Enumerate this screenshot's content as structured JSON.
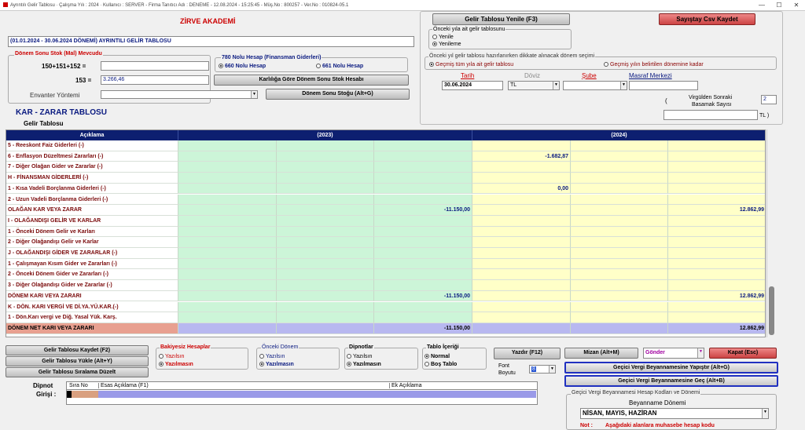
{
  "titlebar": {
    "text": "Ayrıntılı Gelir Tablosu  ·  Çalışma Yılı : 2024  ·  Kullanıcı : SERVER - Firma Tanıtıcı Adı : DENEME - 12.08.2024 - 15:25:45 - Müş.No : 800257 - Ver.No : 010824-05.1",
    "min": "—",
    "max": "☐",
    "close": "✕"
  },
  "company": "ZİRVE AKADEMİ",
  "report_title": "(01.01.2024  -  30.06.2024 DÖNEMİ) AYRINTILI GELİR TABLOSU",
  "stock": {
    "group": "Dönem Sonu Stok (Mal) Mevcudu",
    "label1": "150+151+152 =",
    "label2": "153 =",
    "value2": "3.266,46",
    "envanter_label": "Envanter Yöntemi"
  },
  "hesap780": {
    "title": "780 Nolu Hesap (Finansman Giderleri)",
    "opt1": "660 Nolu Hesap",
    "opt2": "661 Nolu Hesap"
  },
  "btn_karlilik": "Karlılığa Göre Dönem Sonu Stok Hesabı",
  "btn_donem_sonu": "Dönem Sonu Stoğu (Alt+G)",
  "kar_zarar": "KAR - ZARAR TABLOSU",
  "gelir_tablosu": "Gelir Tablosu",
  "btn_yenile": "Gelir Tablosu Yenile (F3)",
  "btn_sayistay": "Sayıştay Csv Kaydet",
  "onceki": {
    "title": "Önceki yıla ait gelir tablosunu",
    "opt1": "Yenile",
    "opt2": "Yenileme"
  },
  "secim": {
    "title": "Önceki yıl gelir tablosu hazırlanırken dikkate alınacak dönem seçimi",
    "opt1": "Geçmiş tüm yıla ait gelir tablosu",
    "opt2": "Geçmiş yılın belirtilen dönemine kadar"
  },
  "filters": {
    "tarih_label": "Tarih",
    "tarih": "30.06.2024",
    "doviz_label": "Döviz",
    "doviz": "TL",
    "sube_label": "Şube",
    "masraf_label": "Masraf Merkezi"
  },
  "basamak": {
    "label1": "Virgülden Sonraki",
    "label2": "Basamak Sayısı",
    "value": "2",
    "paren_open": "(",
    "paren_close": "TL )"
  },
  "grid": {
    "headers": [
      "Açıklama",
      "(2023)",
      "(2024)"
    ],
    "rows": [
      {
        "label": "5 - Reeskont Faiz Giderleri (-)",
        "a": "",
        "b": "",
        "c": "",
        "d": ""
      },
      {
        "label": "6 - Enflasyon Düzeltmesi Zararları (-)",
        "a": "",
        "b": "",
        "c": "-1.682,87",
        "d": ""
      },
      {
        "label": "7 - Diğer Olağan Gider ve Zararlar (-)",
        "a": "",
        "b": "",
        "c": "",
        "d": ""
      },
      {
        "label": "H - FİNANSMAN GİDERLERİ (-)",
        "a": "",
        "b": "",
        "c": "",
        "d": ""
      },
      {
        "label": "1 - Kısa Vadeli Borçlanma Giderleri (-)",
        "a": "",
        "b": "",
        "c": "0,00",
        "d": ""
      },
      {
        "label": "2 - Uzun Vadeli Borçlanma Giderleri (-)",
        "a": "",
        "b": "",
        "c": "",
        "d": ""
      },
      {
        "label": "OLAĞAN KAR VEYA ZARAR",
        "a": "",
        "b": "-11.150,00",
        "c": "",
        "d": "12.862,99"
      },
      {
        "label": "I - OLAĞANDIŞI GELİR VE KARLAR",
        "a": "",
        "b": "",
        "c": "",
        "d": ""
      },
      {
        "label": "1 - Önceki Dönem Gelir ve Karları",
        "a": "",
        "b": "",
        "c": "",
        "d": ""
      },
      {
        "label": "2 - Diğer Olağandışı Gelir ve Karlar",
        "a": "",
        "b": "",
        "c": "",
        "d": ""
      },
      {
        "label": "J - OLAĞANDIŞI GİDER VE ZARARLAR (-)",
        "a": "",
        "b": "",
        "c": "",
        "d": ""
      },
      {
        "label": "1 - Çalışmayan Kısım Gider ve Zararları (-)",
        "a": "",
        "b": "",
        "c": "",
        "d": ""
      },
      {
        "label": "2 - Önceki Dönem Gider ve Zararları (-)",
        "a": "",
        "b": "",
        "c": "",
        "d": ""
      },
      {
        "label": "3 - Diğer Olağandışı Gider ve Zararlar (-)",
        "a": "",
        "b": "",
        "c": "",
        "d": ""
      },
      {
        "label": "DÖNEM KARI VEYA ZARARI",
        "a": "",
        "b": "-11.150,00",
        "c": "",
        "d": "12.862,99"
      },
      {
        "label": "K - DÖN. KARI VERGİ VE Dİ.YA.YÜ.KAR.(-)",
        "a": "",
        "b": "",
        "c": "",
        "d": ""
      },
      {
        "label": "1 - Dön.Karı vergi ve Diğ. Yasal Yük. Karş.",
        "a": "",
        "b": "",
        "c": "",
        "d": ""
      },
      {
        "label": "DÖNEM NET KARI VEYA ZARARI",
        "a": "",
        "b": "-11.150,00",
        "c": "",
        "d": "12.862,99",
        "total": true
      }
    ]
  },
  "bottom": {
    "btn_kaydet": "Gelir Tablosu Kaydet (F2)",
    "btn_yukle": "Gelir Tablosu Yükle (Alt+Y)",
    "btn_siralama": "Gelir Tablosu Sıralama Düzelt",
    "bakiyesiz": {
      "title": "Bakiyesiz Hesaplar",
      "opt1": "Yazılsın",
      "opt2": "Yazılmasın"
    },
    "onceki_donem": {
      "title": "Önceki Dönem",
      "opt1": "Yazılsın",
      "opt2": "Yazılmasın"
    },
    "dipnotlar": {
      "title": "Dipnotlar",
      "opt1": "Yazılsın",
      "opt2": "Yazılmasın"
    },
    "tablo_icerigi": {
      "title": "Tablo İçeriği",
      "opt1": "Normal",
      "opt2": "Boş Tablo"
    },
    "btn_yazdir": "Yazdır (F12)",
    "font_label1": "Font",
    "font_label2": "Boyutu",
    "font_value": "8",
    "btn_mizan": "Mizan (Alt+M)",
    "gonder": "Gönder",
    "btn_kapat": "Kapat (Esc)",
    "btn_yapistir": "Geçici Vergi Beyannamesine Yapıştır  (Alt+G)",
    "btn_gec": "Geçici Vergi Beyannamesine Geç (Alt+B)",
    "gvb_group": "Geçici Vergi Beyannamesi Hesap Kodları ve Dönemi",
    "beyan_label": "Beyanname Dönemi",
    "beyan_value": "NİSAN, MAYIS, HAZİRAN",
    "not_label": "Not :",
    "not_text": "Aşağıdaki alanlara muhasebe hesap kodu",
    "dipnot_label1": "Dipnot",
    "dipnot_label2": "Girişi :",
    "dipnot_cols": [
      "Sıra No",
      "Esas Açıklama (F1)",
      "Ek Açıklama"
    ]
  }
}
